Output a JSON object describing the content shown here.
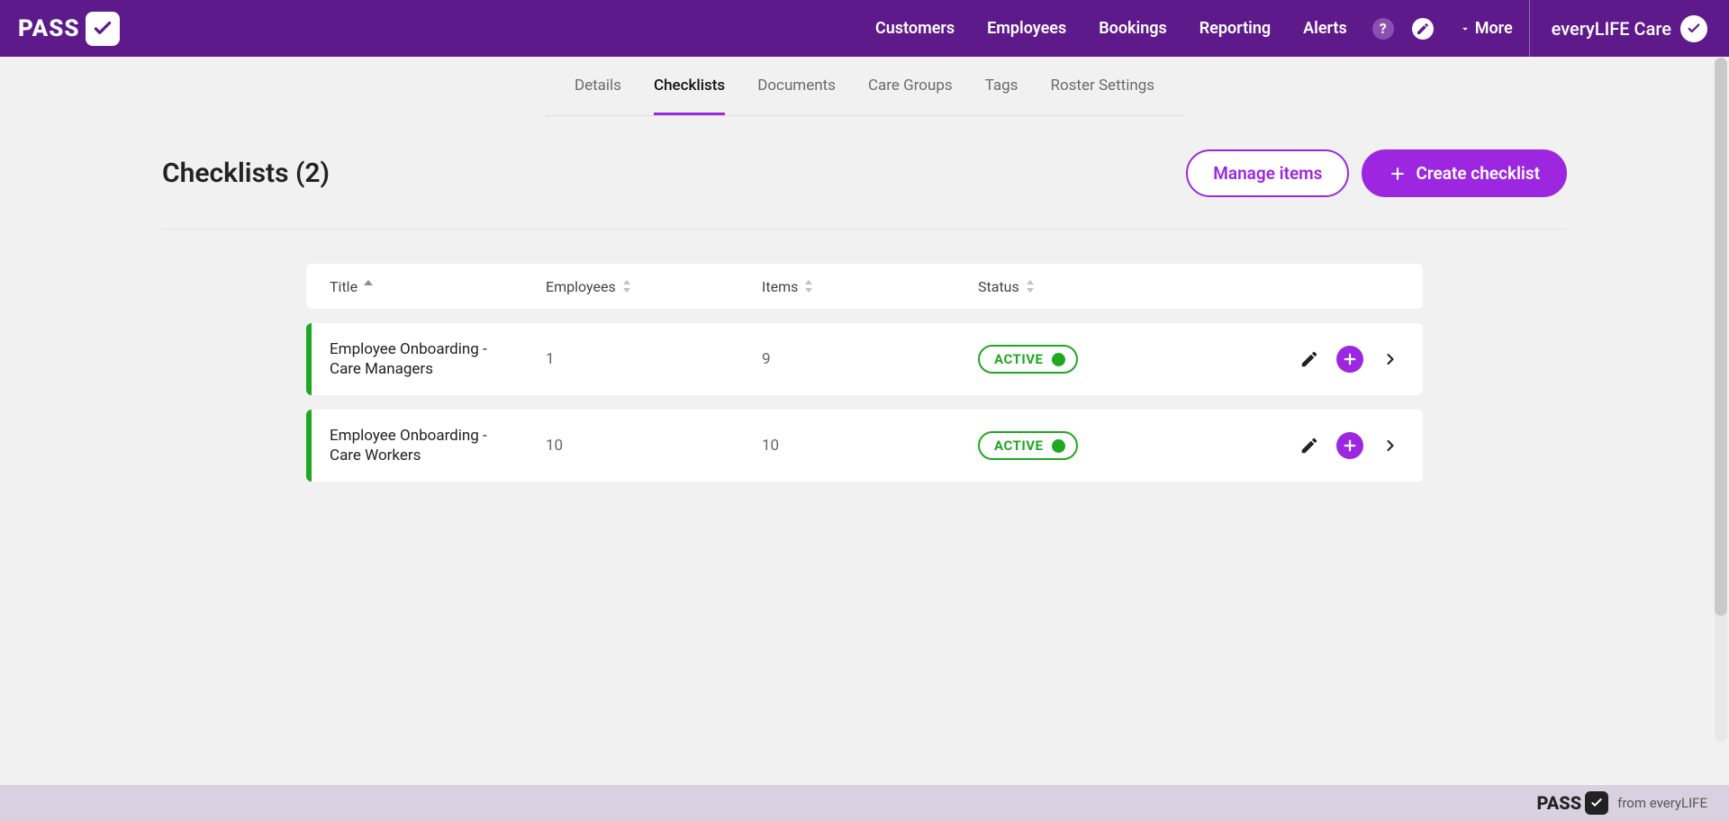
{
  "header": {
    "brand": "PASS",
    "nav": [
      "Customers",
      "Employees",
      "Bookings",
      "Reporting",
      "Alerts"
    ],
    "more_label": "More",
    "account_name": "everyLIFE Care"
  },
  "tabs": {
    "items": [
      "Details",
      "Checklists",
      "Documents",
      "Care Groups",
      "Tags",
      "Roster Settings"
    ],
    "active_index": 1
  },
  "page": {
    "title": "Checklists (2)",
    "actions": {
      "manage": "Manage items",
      "create": "Create checklist"
    }
  },
  "table": {
    "columns": [
      "Title",
      "Employees",
      "Items",
      "Status"
    ],
    "rows": [
      {
        "title": "Employee Onboarding - Care Managers",
        "employees": "1",
        "items": "9",
        "status": "ACTIVE"
      },
      {
        "title": "Employee Onboarding - Care Workers",
        "employees": "10",
        "items": "10",
        "status": "ACTIVE"
      }
    ]
  },
  "footer": {
    "brand": "PASS",
    "text": "from everyLIFE"
  }
}
